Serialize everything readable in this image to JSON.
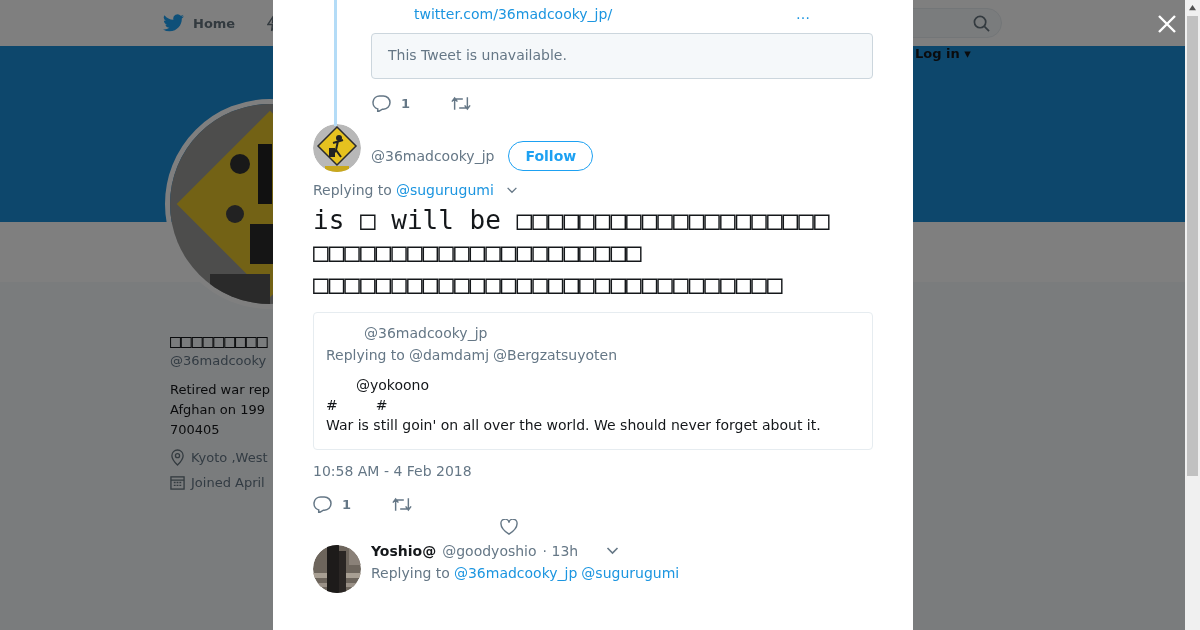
{
  "nav": {
    "home": "Home",
    "login": "Log in",
    "login_caret": "▾"
  },
  "profile": {
    "name": "□□□□□□□□□",
    "handle": "@36madcooky",
    "bio": [
      "Retired war rep",
      "Afghan on 199",
      "700405"
    ],
    "location": "Kyoto ,West",
    "joined": "Joined April"
  },
  "modal": {
    "parent": {
      "link": "twitter.com/36madcooky_jp/",
      "more": "…",
      "unavailable": "This Tweet is unavailable.",
      "replies": "1"
    },
    "tweet": {
      "handle": "@36madcooky_jp",
      "follow": "Follow",
      "replying_label": "Replying to",
      "replying_to": [
        "@sugurugumi"
      ],
      "text_lines": [
        "is □ will be □□□□□□□□□□□□□□□□□□□□",
        "□□□□□□□□□□□□□□□□□□□□□",
        "□□□□□□□□□□□□□□□□□□□□□□□□□□□□□□"
      ],
      "quote": {
        "handle": "@36madcooky_jp",
        "replying_label": "Replying to",
        "replying_to": [
          "@damdamj",
          "@Bergzatsuyoten"
        ],
        "mention": "@yokoono",
        "tags": [
          "#",
          "#"
        ],
        "text": "War is still goin' on all over the world. We should never forget about it."
      },
      "time": "10:58 AM - 4 Feb 2018",
      "replies": "1"
    },
    "reply": {
      "name": "Yoshio@",
      "handle": "@goodyoshio",
      "time": "· 13h",
      "replying_label": "Replying to",
      "replying_to": [
        "@36madcooky_jp",
        "@sugurugumi"
      ]
    }
  }
}
